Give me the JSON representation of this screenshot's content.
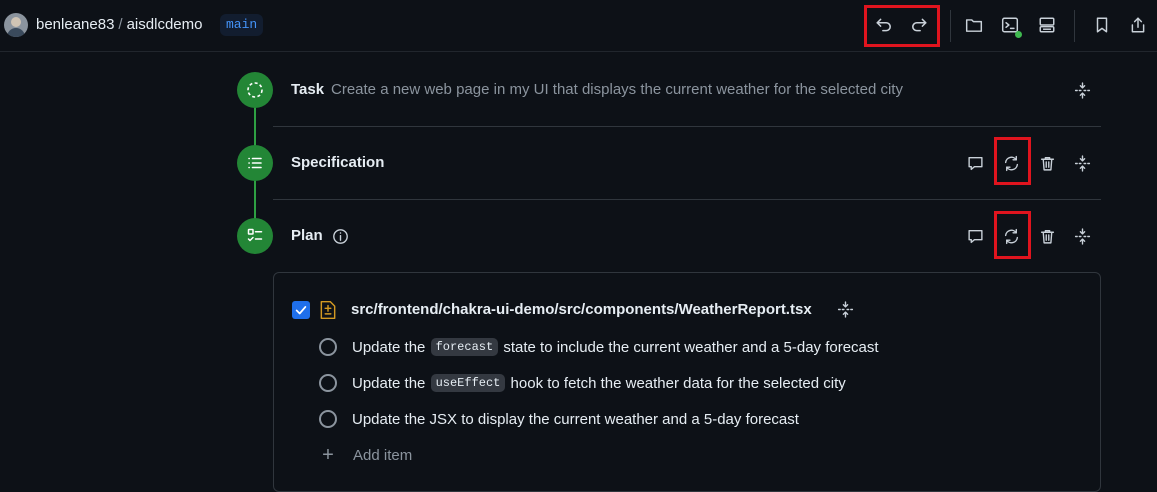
{
  "header": {
    "owner": "benleane83",
    "separator": "/",
    "repo": "aisdlcdemo",
    "branch": "main",
    "icons": [
      "undo-icon",
      "redo-icon",
      "folder-icon",
      "terminal-icon",
      "server-icon",
      "bookmark-icon",
      "share-icon"
    ]
  },
  "steps": {
    "task": {
      "title": "Task",
      "text": "Create a new web page in my UI that displays the current weather for the selected city"
    },
    "specification": {
      "title": "Specification"
    },
    "plan": {
      "title": "Plan"
    }
  },
  "plan": {
    "file_path": "src/frontend/chakra-ui-demo/src/components/WeatherReport.tsx",
    "file_checked": true,
    "items": [
      {
        "before": "Update the",
        "code": "forecast",
        "after": "state to include the current weather and a 5-day forecast"
      },
      {
        "before": "Update the",
        "code": "useEffect",
        "after": "hook to fetch the weather data for the selected city"
      },
      {
        "text": "Update the JSX to display the current weather and a 5-day forecast"
      }
    ],
    "add_item_label": "Add item"
  },
  "colors": {
    "background": "#0d1117",
    "step_green": "#238636",
    "branch_blue": "#4493f8",
    "highlight_red": "#e0141e"
  }
}
